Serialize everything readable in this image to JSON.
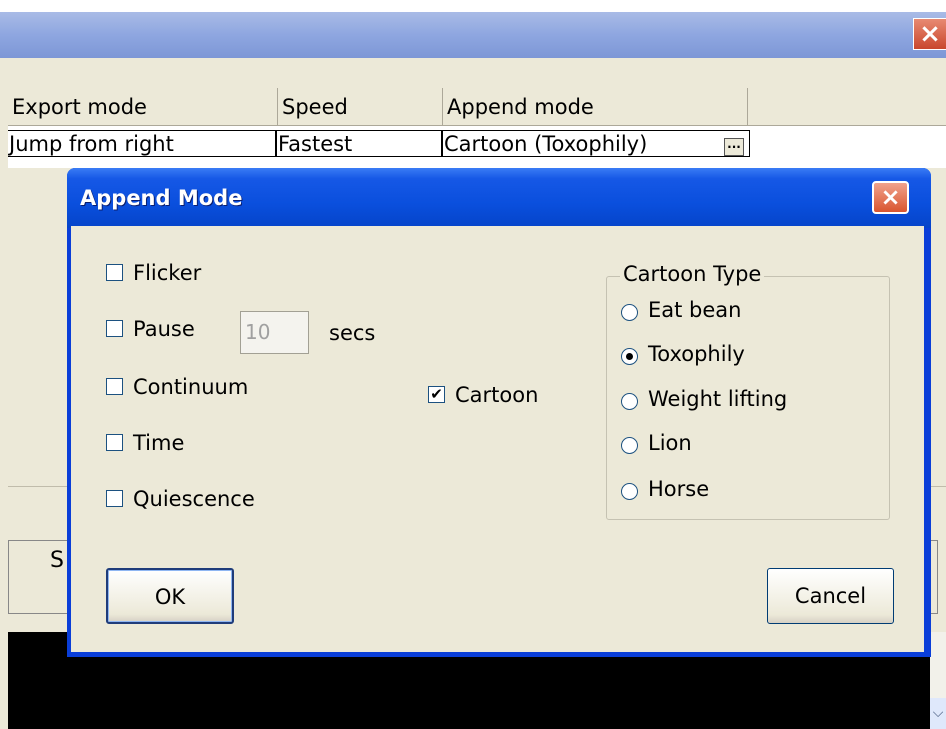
{
  "background_window": {
    "close_glyph": "×",
    "grid": {
      "columns": [
        "Export mode",
        "Speed",
        "Append mode"
      ],
      "row": [
        "Jump from right",
        "Fastest",
        "Cartoon (Toxophily)"
      ],
      "ellipsis_button": "..."
    },
    "partial_button_label": "S"
  },
  "dialog": {
    "title": "Append Mode",
    "close_glyph": "×",
    "options": {
      "flicker": {
        "label": "Flicker",
        "checked": false
      },
      "pause": {
        "label": "Pause",
        "checked": false,
        "value": "10",
        "unit": "secs"
      },
      "continuum": {
        "label": "Continuum",
        "checked": false
      },
      "time": {
        "label": "Time",
        "checked": false
      },
      "quiescence": {
        "label": "Quiescence",
        "checked": false
      },
      "cartoon": {
        "label": "Cartoon",
        "checked": true
      }
    },
    "cartoon_type": {
      "legend": "Cartoon Type",
      "items": [
        "Eat bean",
        "Toxophily",
        "Weight lifting",
        "Lion",
        "Horse"
      ],
      "selected": "Toxophily"
    },
    "buttons": {
      "ok": "OK",
      "cancel": "Cancel"
    }
  },
  "colors": {
    "title_blue": "#0a4fdd",
    "window_face": "#ece9d8",
    "close_red": "#d9552f"
  }
}
